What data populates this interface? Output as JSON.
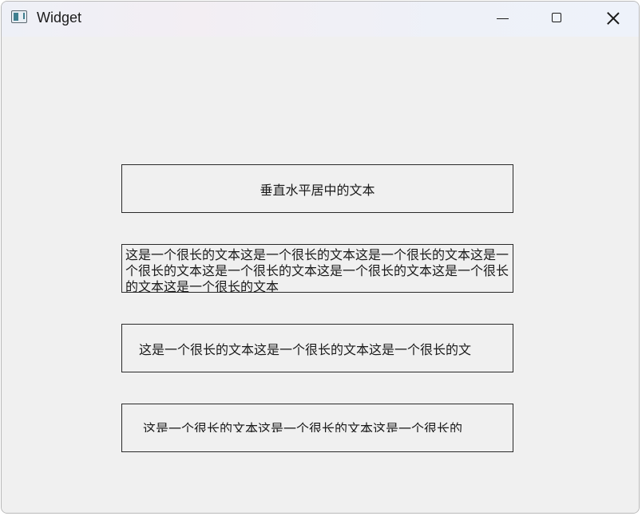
{
  "window": {
    "title": "Widget",
    "icon": "qt-widget-app-icon",
    "controls": {
      "minimize": "minimize-icon",
      "maximize": "maximize-icon",
      "close": "close-icon"
    }
  },
  "labels": [
    {
      "text": "垂直水平居中的文本"
    },
    {
      "text": "这是一个很长的文本这是一个很长的文本这是一个很长的文本这是一个很长的文本这是一个很长的文本这是一个很长的文本这是一个很长的文本这是一个很长的文本"
    },
    {
      "text": "这是一个很长的文本这是一个很长的文本这是一个很长的文"
    },
    {
      "text": "这是一个很长的文本这是一个很长的文本这是一个很长的"
    }
  ]
}
